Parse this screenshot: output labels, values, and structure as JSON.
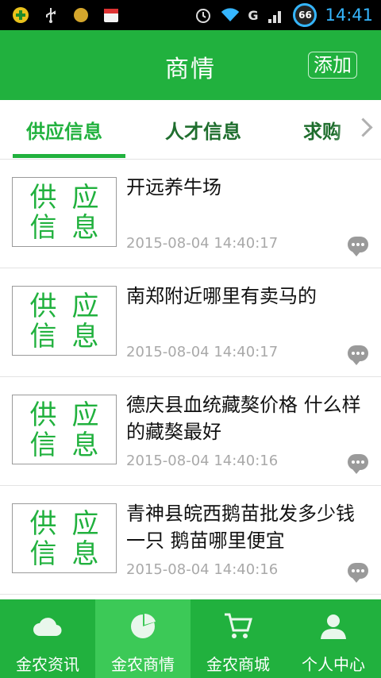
{
  "status_bar": {
    "time": "14:41",
    "battery": "66",
    "network": "G"
  },
  "header": {
    "title": "商情",
    "add_label": "添加"
  },
  "tabs": [
    {
      "label": "供应信息",
      "active": true
    },
    {
      "label": "人才信息",
      "active": false
    },
    {
      "label": "求购",
      "active": false
    }
  ],
  "thumb_text": [
    "供",
    "应",
    "信",
    "息"
  ],
  "items": [
    {
      "title": "开远养牛场",
      "time": "2015-08-04 14:40:17"
    },
    {
      "title": "南郑附近哪里有卖马的",
      "time": "2015-08-04 14:40:17"
    },
    {
      "title": "德庆县血统藏獒价格  什么样的藏獒最好",
      "time": "2015-08-04 14:40:16"
    },
    {
      "title": "青神县皖西鹅苗批发多少钱一只 鹅苗哪里便宜",
      "time": "2015-08-04 14:40:16"
    }
  ],
  "bottom_nav": [
    {
      "label": "金农资讯",
      "icon": "cloud-icon",
      "active": false
    },
    {
      "label": "金农商情",
      "icon": "pie-chart-icon",
      "active": true
    },
    {
      "label": "金农商城",
      "icon": "cart-icon",
      "active": false
    },
    {
      "label": "个人中心",
      "icon": "person-icon",
      "active": false
    }
  ],
  "colors": {
    "primary": "#21b13e",
    "active_nav": "#3cc957",
    "clock": "#35b6ff"
  }
}
